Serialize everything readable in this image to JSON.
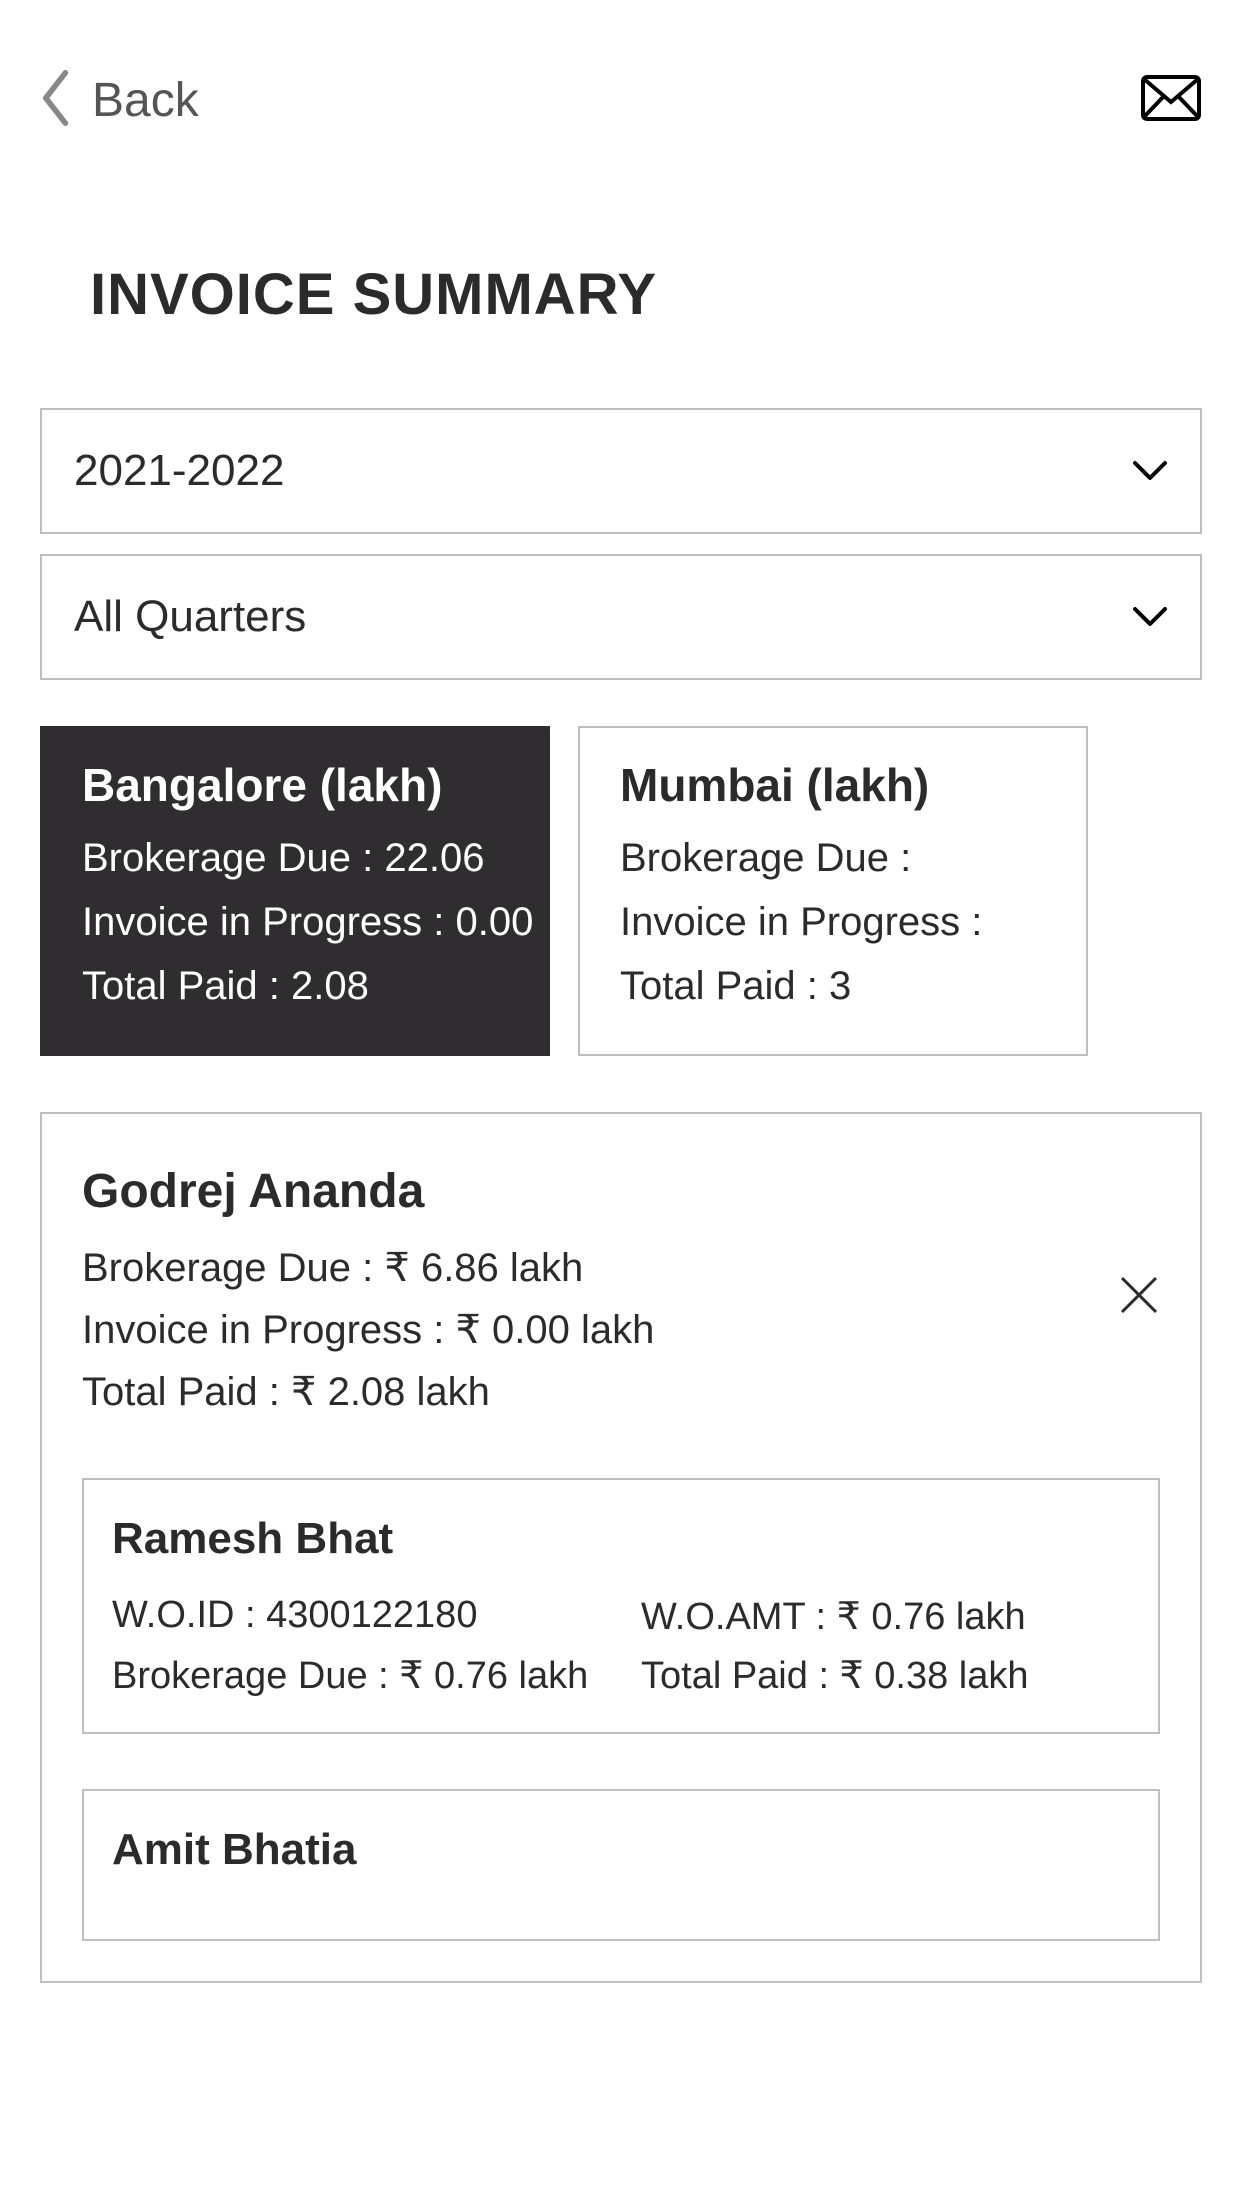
{
  "header": {
    "back_label": "Back"
  },
  "page": {
    "title": "INVOICE SUMMARY"
  },
  "filters": {
    "year": "2021-2022",
    "quarter": "All Quarters"
  },
  "cities": [
    {
      "name": "Bangalore (lakh)",
      "brokerage_due": "Brokerage Due : 22.06",
      "invoice_in_progress": "Invoice in Progress : 0.00",
      "total_paid": "Total Paid : 2.08",
      "active": true
    },
    {
      "name": "Mumbai (lakh)",
      "brokerage_due": "Brokerage Due :",
      "invoice_in_progress": "Invoice in Progress :",
      "total_paid": "Total Paid : 3",
      "active": false
    }
  ],
  "project": {
    "name": "Godrej Ananda",
    "brokerage_due": "Brokerage Due : ₹ 6.86 lakh",
    "invoice_in_progress": "Invoice in Progress : ₹ 0.00 lakh",
    "total_paid": "Total Paid : ₹ 2.08 lakh"
  },
  "customers": [
    {
      "name": "Ramesh Bhat",
      "wo_id": "W.O.ID : 4300122180",
      "wo_amt": "W.O.AMT : ₹ 0.76 lakh",
      "brokerage_due": "Brokerage Due : ₹ 0.76 lakh",
      "total_paid": "Total Paid : ₹ 0.38 lakh"
    },
    {
      "name": "Amit Bhatia"
    }
  ]
}
